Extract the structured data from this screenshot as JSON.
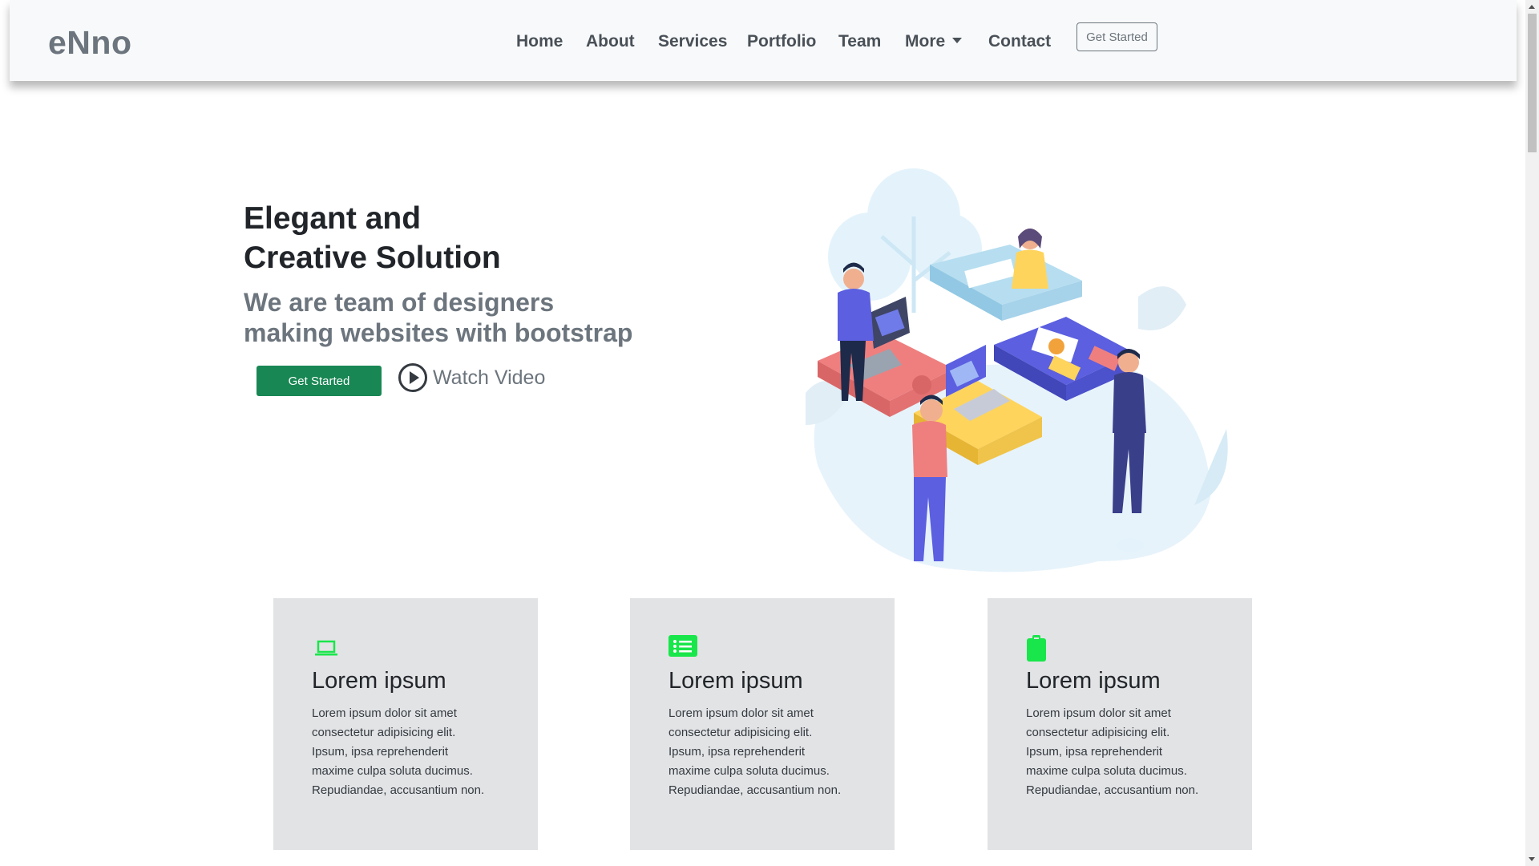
{
  "navbar": {
    "brand": "eNno",
    "links": [
      "Home",
      "About",
      "Services",
      "Portfolio",
      "Team",
      "More",
      "Contact"
    ],
    "cta_label": "Get Started",
    "more_icon": "caret-down-icon"
  },
  "hero": {
    "title_line1": "Elegant and",
    "title_line2": "Creative Solution",
    "subtitle_line1": "We are team of designers",
    "subtitle_line2": "making websites with bootstrap",
    "cta_label": "Get Started",
    "video_label": "Watch Video",
    "video_icon": "play-circle-icon",
    "illustration": "team-puzzle-illustration"
  },
  "cards": [
    {
      "icon": "laptop-icon",
      "title": "Lorem ipsum",
      "lines": [
        "Lorem ipsum dolor sit amet",
        "consectetur adipisicing elit.",
        "Ipsum, ipsa reprehenderit",
        "maxime culpa soluta ducimus.",
        "Repudiandae, accusantium non."
      ]
    },
    {
      "icon": "list-icon",
      "title": "Lorem ipsum",
      "lines": [
        "Lorem ipsum dolor sit amet",
        "consectetur adipisicing elit.",
        "Ipsum, ipsa reprehenderit",
        "maxime culpa soluta ducimus.",
        "Repudiandae, accusantium non."
      ]
    },
    {
      "icon": "clipboard-icon",
      "title": "Lorem ipsum",
      "lines": [
        "Lorem ipsum dolor sit amet",
        "consectetur adipisicing elit.",
        "Ipsum, ipsa reprehenderit",
        "maxime culpa soluta ducimus.",
        "Repudiandae, accusantium non."
      ]
    }
  ],
  "colors": {
    "accent_green": "#198754",
    "icon_green": "#19e64a",
    "card_bg": "#e2e3e5",
    "navbar_bg": "#f8f9fa"
  }
}
